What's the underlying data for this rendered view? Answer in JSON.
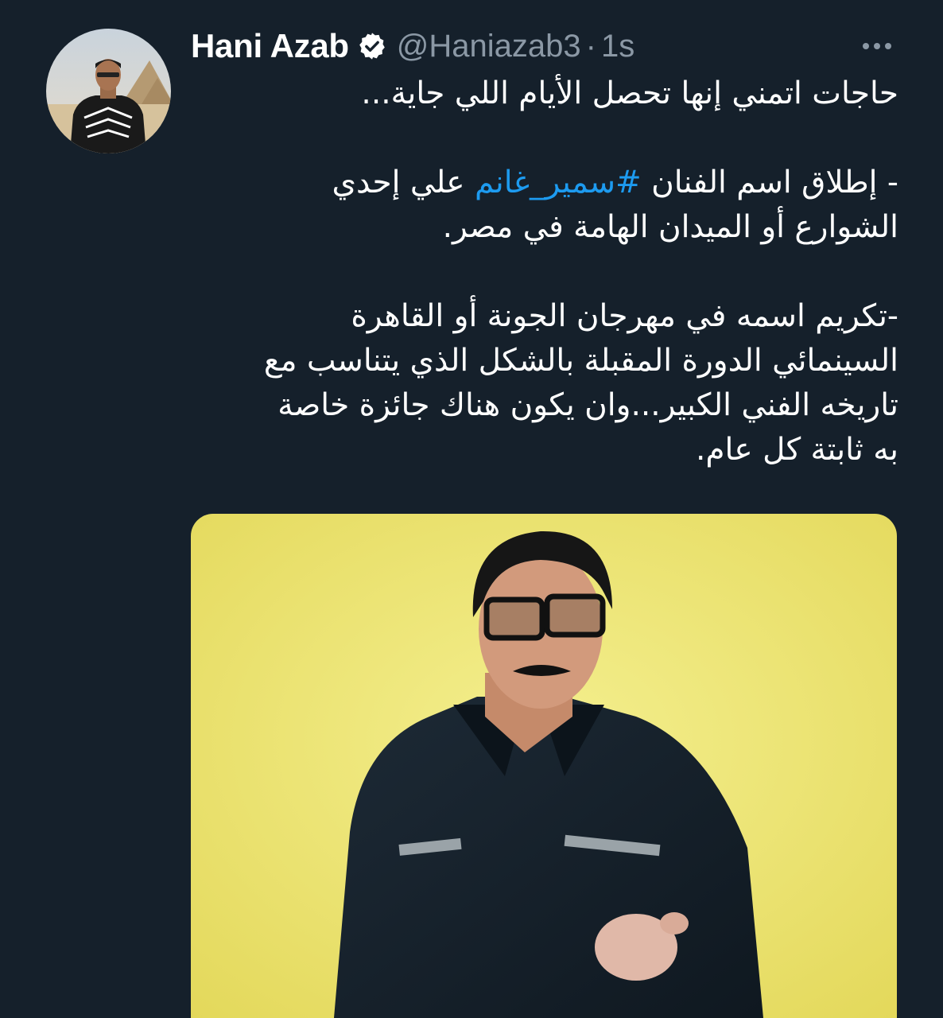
{
  "tweet": {
    "author": {
      "display_name": "Hani Azab",
      "handle": "@Haniazab3",
      "verified": true,
      "verified_icon": "verified-badge-icon"
    },
    "separator": "·",
    "timestamp": "1s",
    "more_icon": "more-horizontal-icon",
    "text": {
      "line1": "حاجات اتمني إنها تحصل الأيام اللي جاية...",
      "line2_before": "- إطلاق اسم الفنان ",
      "line2_hashtag": "#سمير_غانم",
      "line2_after": " علي إحدي",
      "line3": "الشوارع أو الميدان الهامة في مصر.",
      "line4": "-تكريم اسمه في مهرجان الجونة أو القاهرة",
      "line5": "السينمائي الدورة المقبلة بالشكل الذي يتناسب مع",
      "line6": "تاريخه الفني الكبير...وان يكون هناك جائزة خاصة",
      "line7": "به ثابتة كل عام."
    },
    "colors": {
      "background": "#15202b",
      "text": "#ffffff",
      "secondary": "#8b98a5",
      "link": "#1d9bf0",
      "media_background": "#efe674"
    }
  }
}
